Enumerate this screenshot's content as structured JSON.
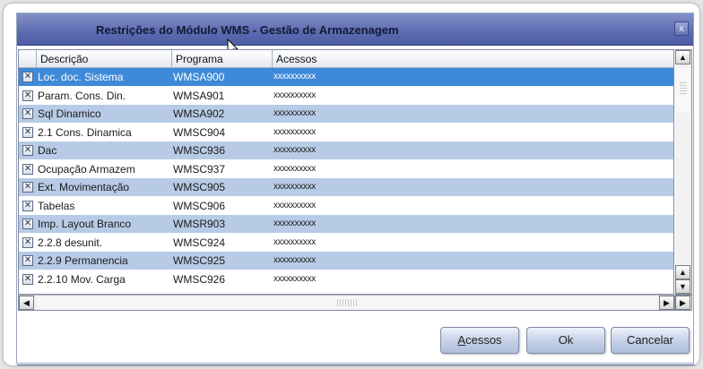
{
  "window": {
    "title": "Restrições do Módulo WMS - Gestão de Armazenagem",
    "close_label": "x"
  },
  "table": {
    "headers": [
      "Descrição",
      "Programa",
      "Acessos"
    ],
    "rows": [
      {
        "checked": true,
        "descricao": "Loc. doc. Sistema",
        "programa": "WMSA900",
        "acessos": "xxxxxxxxxx",
        "selected": true
      },
      {
        "checked": true,
        "descricao": "Param. Cons. Din.",
        "programa": "WMSA901",
        "acessos": "xxxxxxxxxx"
      },
      {
        "checked": true,
        "descricao": "Sql Dinamico",
        "programa": "WMSA902",
        "acessos": "xxxxxxxxxx"
      },
      {
        "checked": true,
        "descricao": "2.1 Cons. Dinamica",
        "programa": "WMSC904",
        "acessos": "xxxxxxxxxx"
      },
      {
        "checked": true,
        "descricao": "Dac",
        "programa": "WMSC936",
        "acessos": "xxxxxxxxxx"
      },
      {
        "checked": true,
        "descricao": "Ocupação Armazem",
        "programa": "WMSC937",
        "acessos": "xxxxxxxxxx"
      },
      {
        "checked": true,
        "descricao": "Ext. Movimentação",
        "programa": "WMSC905",
        "acessos": "xxxxxxxxxx"
      },
      {
        "checked": true,
        "descricao": "Tabelas",
        "programa": "WMSC906",
        "acessos": "xxxxxxxxxx"
      },
      {
        "checked": true,
        "descricao": "Imp. Layout Branco",
        "programa": "WMSR903",
        "acessos": "xxxxxxxxxx"
      },
      {
        "checked": true,
        "descricao": "2.2.8 desunit.",
        "programa": "WMSC924",
        "acessos": "xxxxxxxxxx"
      },
      {
        "checked": true,
        "descricao": "2.2.9 Permanencia",
        "programa": "WMSC925",
        "acessos": "xxxxxxxxxx"
      },
      {
        "checked": true,
        "descricao": "2.2.10 Mov. Carga",
        "programa": "WMSC926",
        "acessos": "xxxxxxxxxx"
      }
    ]
  },
  "buttons": {
    "acessos_prefix": "A",
    "acessos_rest": "cessos",
    "ok": "Ok",
    "cancelar": "Cancelar"
  },
  "colors": {
    "titlebar": "#5e6db1",
    "row_alt": "#b7cbe6",
    "row_selected": "#3e8ad8"
  },
  "icons": {
    "checkbox": "checked-box-icon",
    "cursor": "mouse-pointer-icon"
  }
}
